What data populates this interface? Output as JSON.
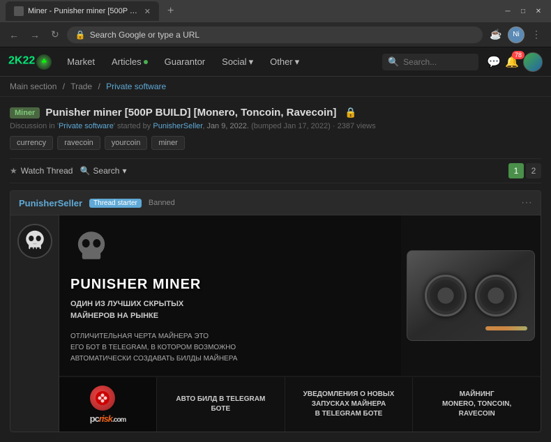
{
  "browser": {
    "tab_title": "Miner - Punisher miner [500P BU...",
    "url": "Search Google or type a URL",
    "favicon": "M"
  },
  "nav": {
    "logo": "2K22",
    "items": [
      {
        "label": "Market",
        "dot": false
      },
      {
        "label": "Articles",
        "dot": true
      },
      {
        "label": "Guarantor",
        "dot": false
      },
      {
        "label": "Social",
        "dot": false,
        "dropdown": true
      },
      {
        "label": "Other",
        "dot": false,
        "dropdown": true
      }
    ],
    "search_placeholder": "Search...",
    "notifications_count": "78"
  },
  "breadcrumb": {
    "items": [
      "Main section",
      "Trade",
      "Private software"
    ]
  },
  "thread": {
    "category_badge": "Miner",
    "title": "Punisher miner [500P BUILD] [Monero, Toncoin, Ravecoin]",
    "meta_prefix": "Discussion in '",
    "meta_forum": "Private software",
    "meta_suffix": "' started by",
    "meta_author": "PunisherSeller",
    "meta_date": "Jan 9, 2022.",
    "meta_bump": "(bumped Jan 17, 2022)",
    "meta_views": "2387 views",
    "tags": [
      "currency",
      "ravecoin",
      "yourcoin",
      "miner"
    ],
    "watch_label": "Watch Thread",
    "search_label": "Search",
    "page_1": "1",
    "page_2": "2"
  },
  "post": {
    "author": "PunisherSeller",
    "badge_starter": "Thread starter",
    "badge_banned": "Banned",
    "options": "···",
    "banner_title": "PUNISHER MINER",
    "banner_subtitle": "ОДИН ИЗ ЛУЧШИХ СКРЫТЫХ\nМАЙНЕРОВ НА РЫНКЕ",
    "banner_desc": "ОТЛИЧИТЕЛЬНАЯ ЧЕРТА МАЙНЕРА ЭТО\nЕГО БОТ В TELEGRAM, В КОТОРОМ ВОЗМОЖНО\nАВТОМАТИЧЕСКИ СОЗДАВАТЬ БИЛДЫ МАЙНЕРА"
  },
  "features": [
    {
      "text": "АВТО БИЛД В TELEGRAM\nБОТЕ"
    },
    {
      "text": "УВЕДОМЛЕНИЯ О НОВЫХ\nЗАПУСКАХ МАЙНЕРА\nВ TELEGRAM БОТЕ"
    },
    {
      "text": "МАЙНИНГ\nMONERO, TONCOIN,\nRAVECOIN"
    }
  ],
  "pcrisk": {
    "pc": "pc",
    "risk": "risk",
    "com": ".com"
  }
}
